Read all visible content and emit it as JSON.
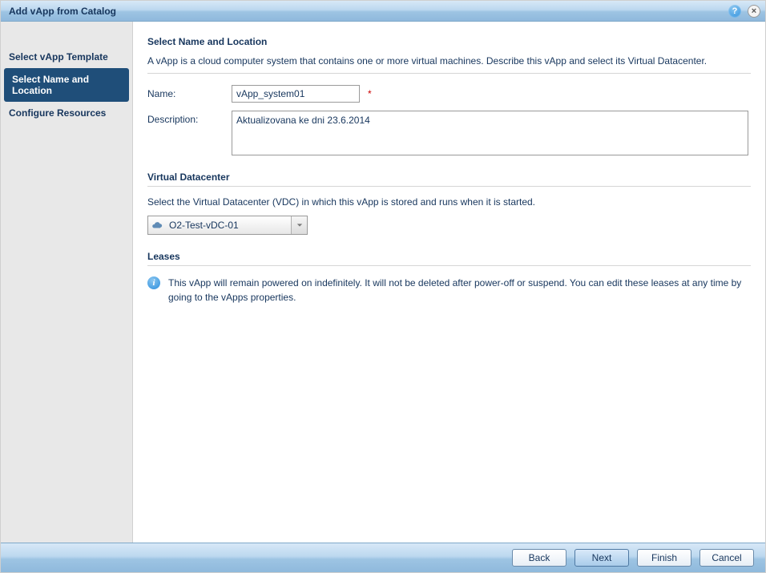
{
  "titlebar": {
    "title": "Add vApp from Catalog"
  },
  "sidebar": {
    "steps": [
      {
        "label": "Select vApp Template",
        "active": false
      },
      {
        "label": "Select Name and Location",
        "active": true
      },
      {
        "label": "Configure Resources",
        "active": false
      }
    ]
  },
  "content": {
    "section_title": "Select Name and Location",
    "intro": "A vApp is a cloud computer system that contains one or more virtual machines. Describe this vApp and select its Virtual Datacenter.",
    "name_label": "Name:",
    "name_value": "vApp_system01",
    "required_marker": "*",
    "desc_label": "Description:",
    "desc_value": "Aktualizovana ke dni 23.6.2014",
    "vdc": {
      "title": "Virtual Datacenter",
      "help": "Select the Virtual Datacenter (VDC) in which this vApp is stored and runs when it is started.",
      "selected": "O2-Test-vDC-01"
    },
    "leases": {
      "title": "Leases",
      "info": "This vApp will remain powered on indefinitely. It will not be deleted after power-off or suspend. You can edit these leases at any time by going to the vApps properties."
    }
  },
  "footer": {
    "back": "Back",
    "next": "Next",
    "finish": "Finish",
    "cancel": "Cancel"
  }
}
